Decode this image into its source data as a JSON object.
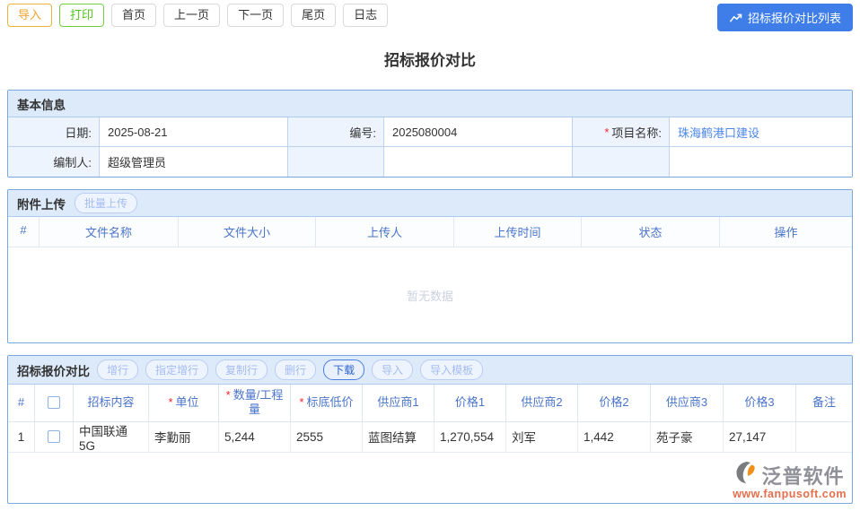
{
  "toolbar": {
    "import_label": "导入",
    "print_label": "打印",
    "home_label": "首页",
    "prev_label": "上一页",
    "next_label": "下一页",
    "last_label": "尾页",
    "log_label": "日志",
    "list_button": "招标报价对比列表"
  },
  "page_title": "招标报价对比",
  "required_mark": "*",
  "colors": {
    "accent_blue": "#3f7ee8",
    "link_blue": "#4a86e8",
    "table_header_blue": "#4a74c9",
    "import_orange": "#f0a32f",
    "print_green": "#52c41a",
    "required_red": "#f5222d",
    "section_border_blue": "#7aa7dd",
    "section_header_bg": "#ddeafa"
  },
  "basic_info": {
    "title": "基本信息",
    "rows": [
      [
        {
          "label": "日期:",
          "value": "2025-08-21"
        },
        {
          "label": "编号:",
          "value": "2025080004"
        },
        {
          "label": "项目名称:",
          "value": "珠海鹤港口建设"
        }
      ],
      [
        {
          "label": "编制人:",
          "value": "超级管理员"
        },
        {
          "label": "",
          "value": ""
        },
        {
          "label": "",
          "value": ""
        }
      ]
    ]
  },
  "attachments": {
    "title": "附件上传",
    "batch_upload_label": "批量上传",
    "columns": [
      "#",
      "文件名称",
      "文件大小",
      "上传人",
      "上传时间",
      "状态",
      "操作"
    ],
    "empty_text": "暂无数据"
  },
  "bid_comparison": {
    "title": "招标报价对比",
    "buttons": {
      "add_row": "增行",
      "insert_row": "指定增行",
      "copy_row": "复制行",
      "delete_row": "删行",
      "download": "下载",
      "import": "导入",
      "import_template": "导入模板"
    },
    "columns": {
      "index": "#",
      "content": "招标内容",
      "unit": "单位",
      "quantity": "数量/工程量",
      "base_price": "标底低价",
      "supplier1": "供应商1",
      "price1": "价格1",
      "supplier2": "供应商2",
      "price2": "价格2",
      "supplier3": "供应商3",
      "price3": "价格3",
      "remark": "备注"
    },
    "rows": [
      {
        "index": "1",
        "content": "中国联通5G",
        "unit": "李勤丽",
        "quantity": "5,244",
        "base_price": "2555",
        "supplier1": "蓝图结算",
        "price1": "1,270,554",
        "supplier2": "刘军",
        "price2": "1,442",
        "supplier3": "苑子豪",
        "price3": "27,147",
        "remark": ""
      }
    ]
  },
  "watermark": {
    "brand": "泛普软件",
    "url": "www.fanpusoft.com"
  }
}
